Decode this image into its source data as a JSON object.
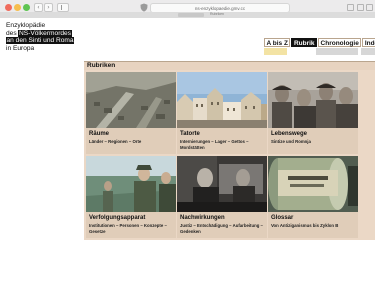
{
  "browser": {
    "url": "ns-enzyklopaedie.gmv.cc",
    "tab_label": "Rubriken"
  },
  "logo": {
    "line1": "Enzyklopädie",
    "line2_prefix": "des",
    "line2_highlight": "NS-Völkermordes",
    "line3_highlight": "an den Sinti und Roma",
    "line4": "in Europa"
  },
  "nav": {
    "tabs": [
      {
        "label": "A bis Z",
        "active": false
      },
      {
        "label": "Rubrik",
        "active": true
      },
      {
        "label": "Chronologie",
        "active": false
      },
      {
        "label": "Inde",
        "active": false
      }
    ]
  },
  "panel": {
    "title": "Rubriken"
  },
  "tiles": [
    {
      "title": "Räume",
      "subtitle": "Länder – Regionen – Orte"
    },
    {
      "title": "Tatorte",
      "subtitle": "Internierungen – Lager – Gettos – Mordstätten"
    },
    {
      "title": "Lebenswege",
      "subtitle": "Sintize und Romnja"
    },
    {
      "title": "Verfolgungsapparat",
      "subtitle": "Institutionen – Personen – Konzepte – Gesetze"
    },
    {
      "title": "Nachwirkungen",
      "subtitle": "Justiz – Entschädigung – Aufarbeitung – Gedenken"
    },
    {
      "title": "Glossar",
      "subtitle": "Von Antiziganismus bis Zyklon B"
    }
  ],
  "colors": {
    "panel_bg": "#ebd8c6",
    "panel_head": "#e7d3c0",
    "tab_border": "#b9a58e",
    "swatch_yellow": "#f3e3a4",
    "swatch_gray": "#d7d7d7"
  }
}
